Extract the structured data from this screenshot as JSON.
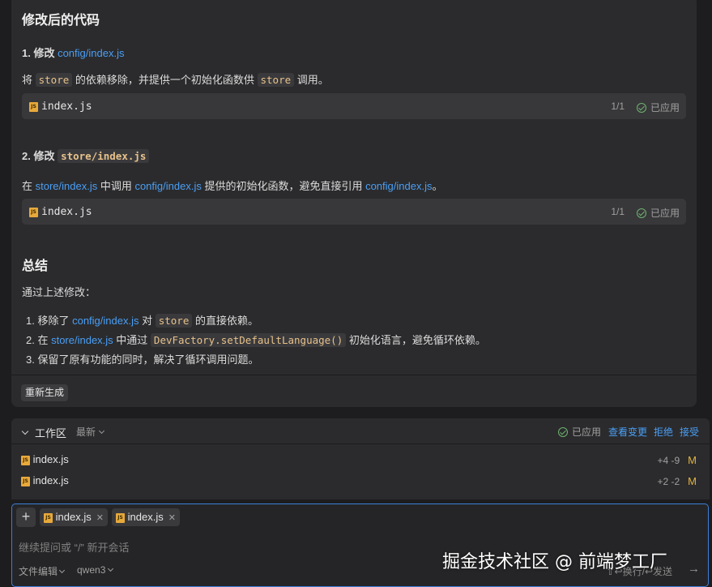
{
  "chat": {
    "section1_title": "修改后的代码",
    "step1": {
      "prefix": "1. 修改 ",
      "link": "config/index.js",
      "desc_a": "将 ",
      "code_a": "store",
      "desc_b": " 的依赖移除，并提供一个初始化函数供 ",
      "code_b": "store",
      "desc_c": " 调用。",
      "block": {
        "file": "index.js",
        "count": "1/1",
        "status": "已应用"
      }
    },
    "step2": {
      "prefix": "2. 修改 ",
      "code": "store/index.js",
      "desc_a": "在 ",
      "link_a": "store/index.js",
      "desc_b": " 中调用 ",
      "link_b": "config/index.js",
      "desc_c": " 提供的初始化函数，避免直接引用 ",
      "link_c": "config/index.js",
      "desc_d": "。",
      "block": {
        "file": "index.js",
        "count": "1/1",
        "status": "已应用"
      }
    },
    "summary_title": "总结",
    "summary_intro": "通过上述修改：",
    "summary_items": [
      {
        "num": "1. ",
        "a": "移除了 ",
        "link": "config/index.js",
        "b": " 对 ",
        "code": "store",
        "c": " 的直接依赖。"
      },
      {
        "num": "2. ",
        "a": "在 ",
        "link": "store/index.js",
        "b": " 中通过 ",
        "code": "DevFactory.setDefaultLanguage()",
        "c": " 初始化语言，避免循环依赖。"
      },
      {
        "num": "3. ",
        "text": "保留了原有功能的同时，解决了循环调用问题。"
      }
    ],
    "regenerate_label": "重新生成"
  },
  "workspace": {
    "title": "工作区",
    "sort": "最新",
    "status": "已应用",
    "view_changes": "查看变更",
    "reject": "拒绝",
    "accept": "接受",
    "files": [
      {
        "name": "index.js",
        "diff": "+4 -9",
        "mark": "M"
      },
      {
        "name": "index.js",
        "diff": "+2 -2",
        "mark": "M"
      }
    ]
  },
  "input": {
    "chips": [
      "index.js",
      "index.js"
    ],
    "placeholder": "继续提问或 “/” 新开会话",
    "mode": "文件编辑",
    "model": "qwen3",
    "hint": "⇧↩换行/↩发送",
    "send_icon": "→"
  },
  "watermark": "掘金技术社区 @ 前端梦工厂",
  "colors": {
    "accent": "#3d7fd6",
    "link": "#4a9ff5",
    "applied": "#6fb36f",
    "modified": "#e2b340"
  }
}
